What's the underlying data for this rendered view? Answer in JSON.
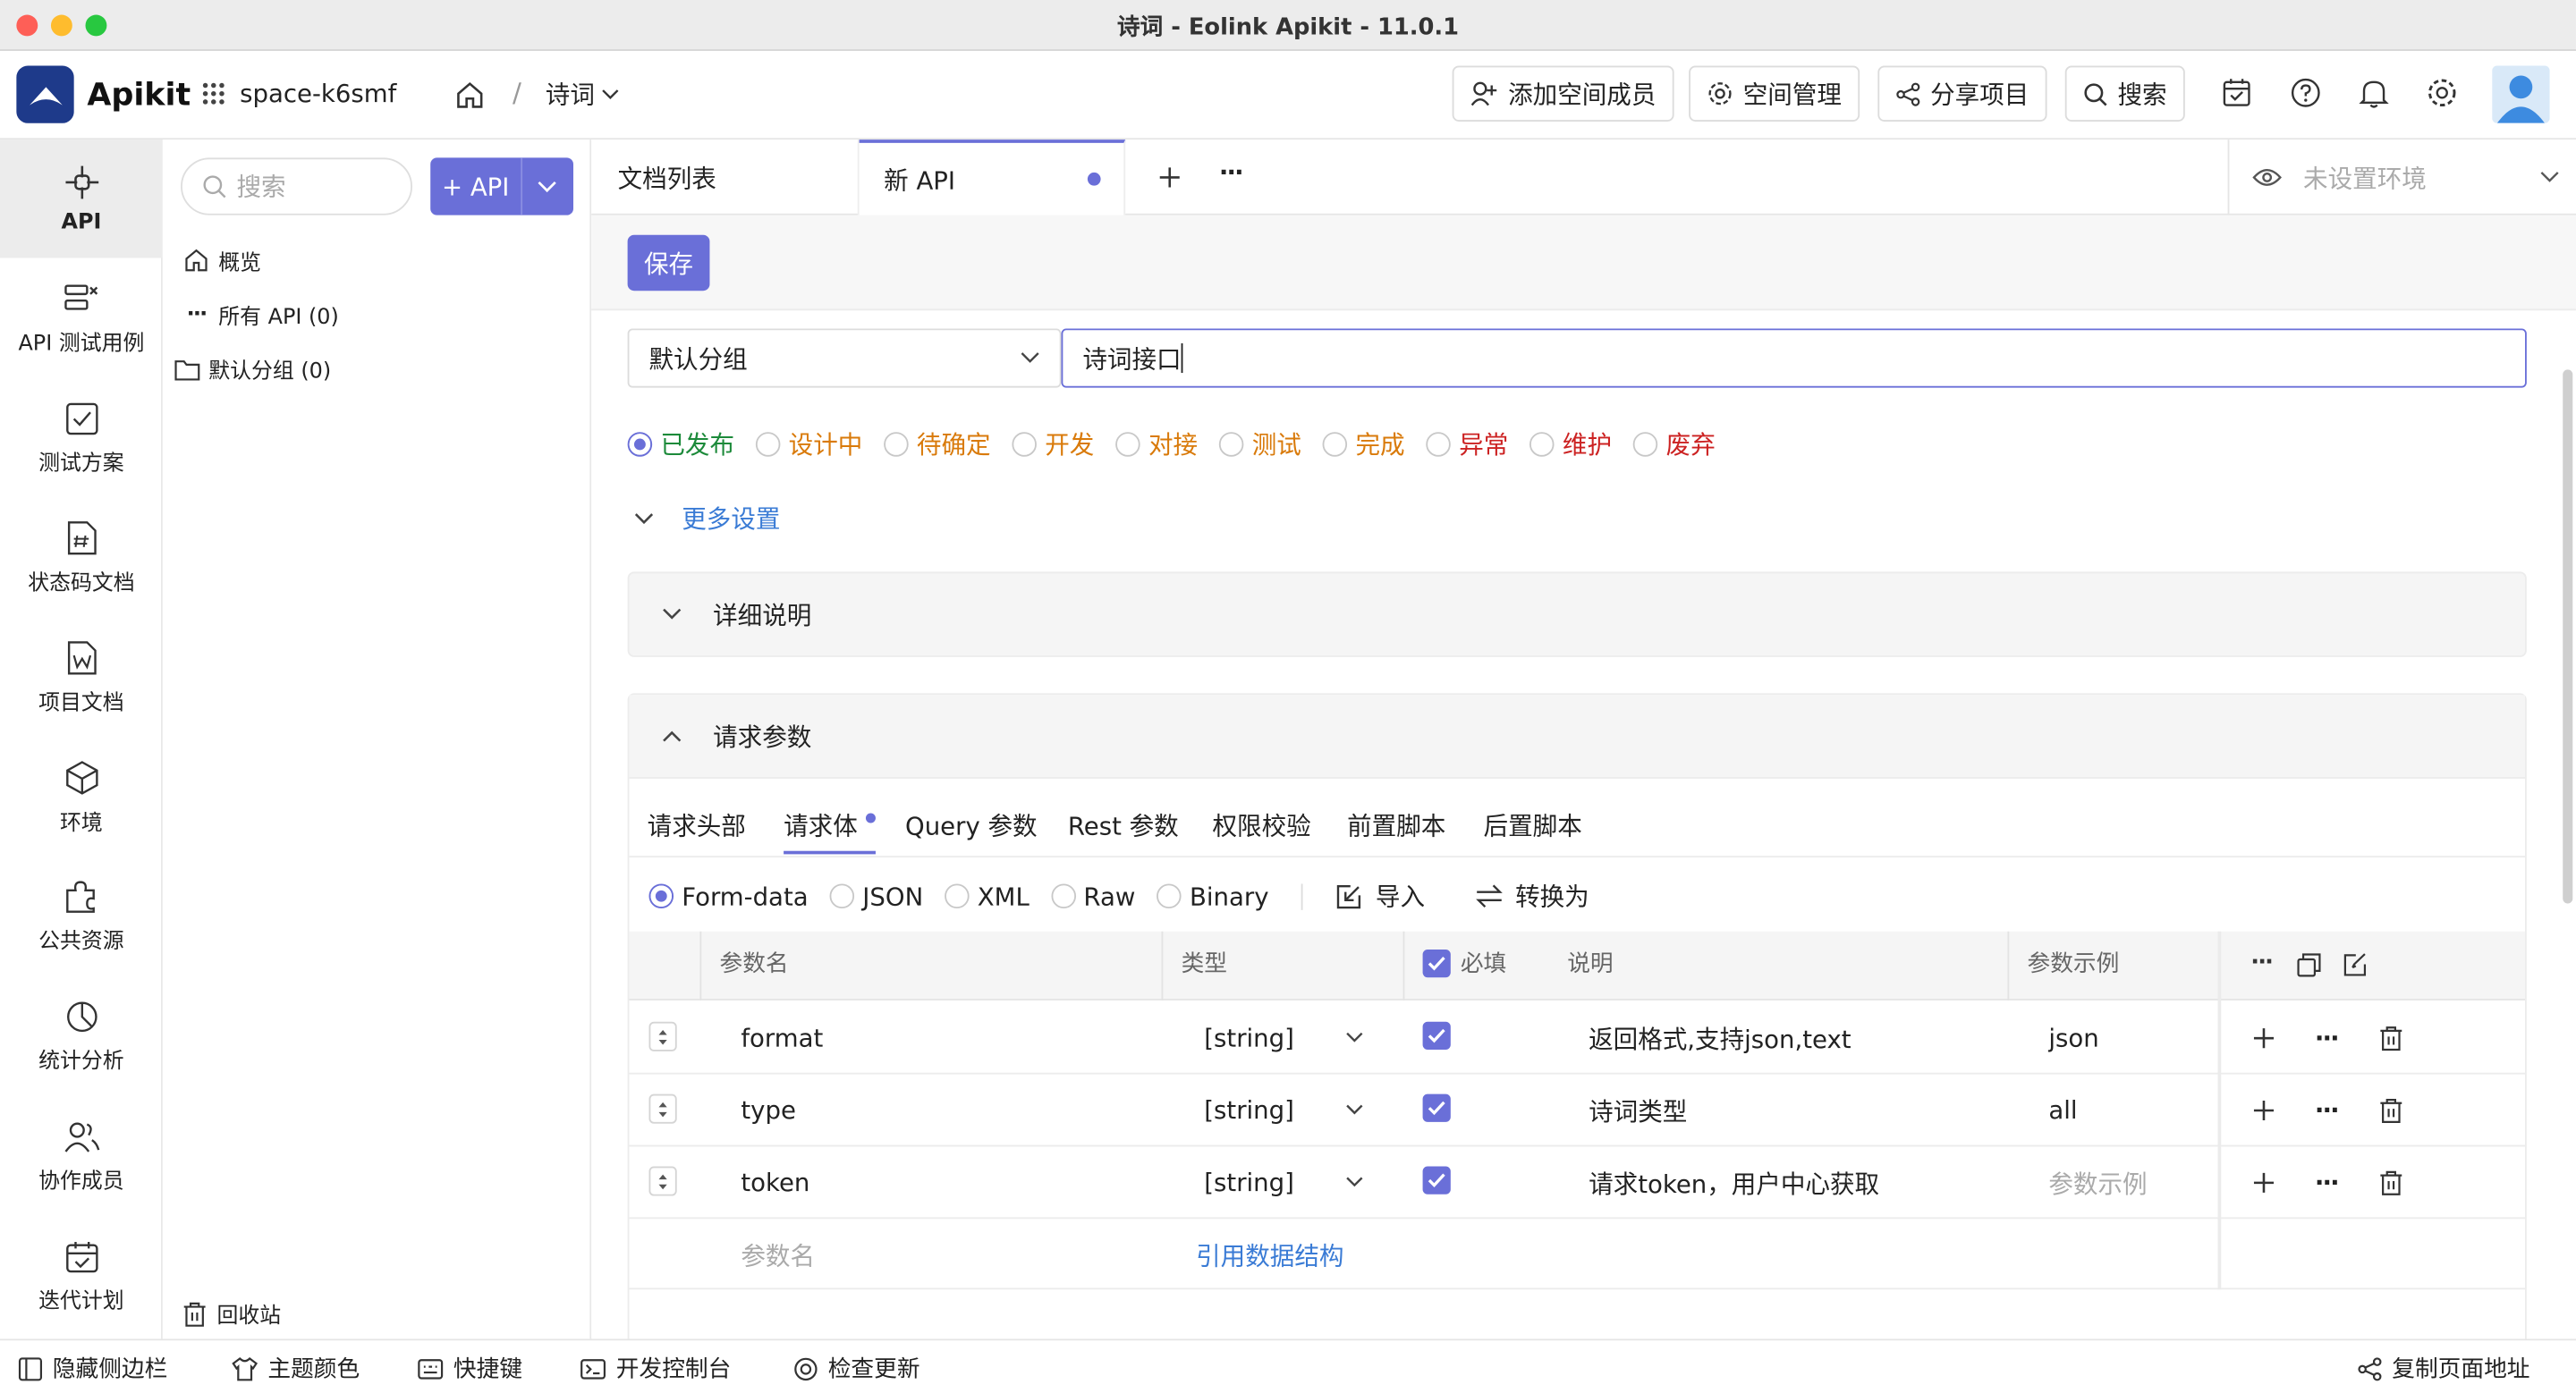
{
  "window": {
    "title": "诗词 - Eolink Apikit - 11.0.1"
  },
  "topnav": {
    "brand": "Apikit",
    "space": "space-k6smf",
    "breadcrumb_sep": "/",
    "project": "诗词",
    "add_member": "添加空间成员",
    "space_manage": "空间管理",
    "share_project": "分享项目",
    "search": "搜索"
  },
  "leftnav": [
    {
      "label": "API",
      "icon": "api-icon"
    },
    {
      "label": "API 测试用例",
      "icon": "test-case-icon"
    },
    {
      "label": "测试方案",
      "icon": "test-plan-icon"
    },
    {
      "label": "状态码文档",
      "icon": "status-code-icon"
    },
    {
      "label": "项目文档",
      "icon": "project-doc-icon"
    },
    {
      "label": "环境",
      "icon": "environment-icon"
    },
    {
      "label": "公共资源",
      "icon": "public-resource-icon"
    },
    {
      "label": "统计分析",
      "icon": "statistics-icon"
    },
    {
      "label": "协作成员",
      "icon": "members-icon"
    },
    {
      "label": "迭代计划",
      "icon": "iteration-icon"
    }
  ],
  "tree": {
    "search_placeholder": "搜索",
    "add_api": "+ API",
    "overview": "概览",
    "all_api": "所有 API (0)",
    "default_group": "默认分组 (0)",
    "recycle": "回收站"
  },
  "tabs": {
    "doc_list": "文档列表",
    "new_api": "新 API",
    "env": "未设置环境"
  },
  "editor": {
    "save": "保存",
    "group": "默认分组",
    "api_name": "诗词接口",
    "statuses": [
      {
        "label": "已发布",
        "color": "#1c8a3a",
        "checked": true
      },
      {
        "label": "设计中",
        "color": "#d97a0a",
        "checked": false
      },
      {
        "label": "待确定",
        "color": "#d97a0a",
        "checked": false
      },
      {
        "label": "开发",
        "color": "#d97a0a",
        "checked": false
      },
      {
        "label": "对接",
        "color": "#d97a0a",
        "checked": false
      },
      {
        "label": "测试",
        "color": "#d97a0a",
        "checked": false
      },
      {
        "label": "完成",
        "color": "#d97a0a",
        "checked": false
      },
      {
        "label": "异常",
        "color": "#cc2222",
        "checked": false
      },
      {
        "label": "维护",
        "color": "#cc2222",
        "checked": false
      },
      {
        "label": "废弃",
        "color": "#cc2222",
        "checked": false
      }
    ],
    "more_settings": "更多设置",
    "detail_desc": "详细说明",
    "request_params": "请求参数"
  },
  "param_tabs": [
    "请求头部",
    "请求体",
    "Query 参数",
    "Rest 参数",
    "权限校验",
    "前置脚本",
    "后置脚本"
  ],
  "body_types": {
    "options": [
      "Form-data",
      "JSON",
      "XML",
      "Raw",
      "Binary"
    ],
    "selected": "Form-data",
    "import": "导入",
    "convert": "转换为"
  },
  "table": {
    "headers": {
      "name": "参数名",
      "type": "类型",
      "required": "必填",
      "desc": "说明",
      "example": "参数示例"
    },
    "rows": [
      {
        "name": "format",
        "type": "[string]",
        "required": true,
        "desc": "返回格式,支持json,text",
        "example": "json"
      },
      {
        "name": "type",
        "type": "[string]",
        "required": true,
        "desc": "诗词类型",
        "example": "all"
      },
      {
        "name": "token",
        "type": "[string]",
        "required": true,
        "desc": "请求token，用户中心获取",
        "example": "参数示例"
      }
    ],
    "new_row_placeholder": "参数名",
    "ref_struct": "引用数据结构"
  },
  "bottombar": {
    "hide_sidebar": "隐藏侧边栏",
    "theme": "主题颜色",
    "shortcuts": "快捷键",
    "devtools": "开发控制台",
    "check_update": "检查更新",
    "copy_url": "复制页面地址"
  },
  "colors": {
    "accent": "#6a6fd8",
    "brand": "#1e3a8a",
    "link": "#3a7bd5"
  }
}
